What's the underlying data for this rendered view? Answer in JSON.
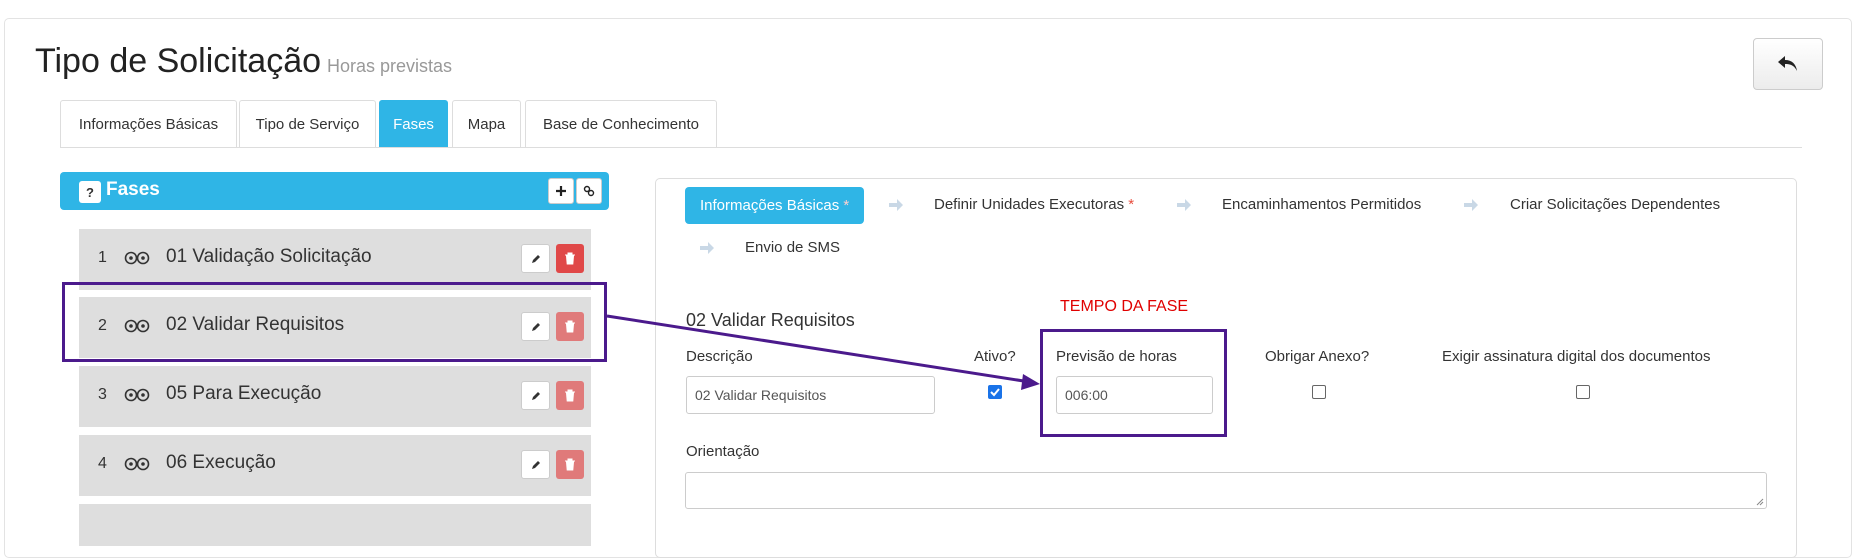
{
  "header": {
    "title": "Tipo de Solicitação",
    "subtitle": "Horas previstas",
    "back_icon": "undo-arrow-icon"
  },
  "tabs": [
    {
      "label": "Informações Básicas",
      "active": false
    },
    {
      "label": "Tipo de Serviço",
      "active": false
    },
    {
      "label": "Fases",
      "active": true
    },
    {
      "label": "Mapa",
      "active": false
    },
    {
      "label": "Base de Conhecimento",
      "active": false
    }
  ],
  "fases_panel": {
    "title": "Fases",
    "help": "?",
    "add_icon": "plus-icon",
    "link_icon": "link-icon"
  },
  "phases": [
    {
      "num": "1",
      "name": "01 Validação Solicitação"
    },
    {
      "num": "2",
      "name": "02 Validar Requisitos"
    },
    {
      "num": "3",
      "name": "05 Para Execução"
    },
    {
      "num": "4",
      "name": "06 Execução"
    }
  ],
  "steps": [
    {
      "label": "Informações Básicas",
      "required": "*"
    },
    {
      "label": "Definir Unidades Executoras",
      "required": "*"
    },
    {
      "label": "Encaminhamentos Permitidos",
      "required": ""
    },
    {
      "label": "Criar Solicitações Dependentes",
      "required": ""
    },
    {
      "label": "Envio de SMS",
      "required": ""
    }
  ],
  "form": {
    "section_title": "02 Validar Requisitos",
    "descricao_label": "Descrição",
    "descricao_value": "02 Validar Requisitos",
    "ativo_label": "Ativo?",
    "ativo_checked": true,
    "previsao_label": "Previsão de horas",
    "previsao_value": "006:00",
    "obrigar_label": "Obrigar Anexo?",
    "obrigar_checked": false,
    "assinatura_label": "Exigir assinatura digital dos documentos",
    "assinatura_checked": false,
    "orientacao_label": "Orientação",
    "orientacao_value": ""
  },
  "annotation": {
    "text": "TEMPO DA FASE",
    "color": "#e00000",
    "box_color": "#4b1a8c"
  },
  "colors": {
    "accent": "#2fb5e6",
    "danger": "#e04848",
    "row_bg": "#dedede"
  }
}
